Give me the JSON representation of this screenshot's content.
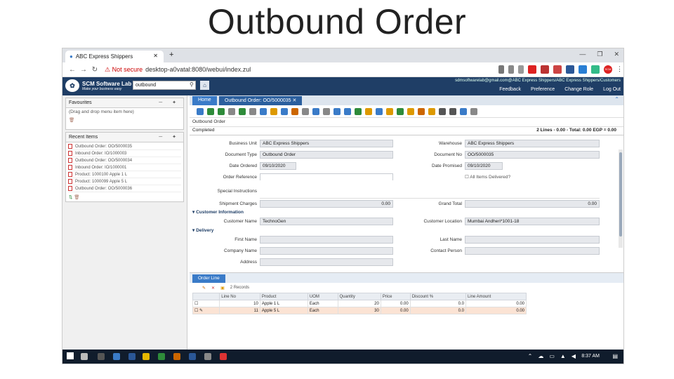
{
  "slide": {
    "title": "Outbound Order"
  },
  "browser": {
    "tab_title": "ABC Express Shippers",
    "security": "Not secure",
    "url": "desktop-a0vatal:8080/webui/index.zul",
    "profile_badge": "SCM"
  },
  "app": {
    "logo_title": "SCM Software Lab",
    "logo_subtitle": "Make your business easy",
    "search_value": "outbound",
    "user_line": "sdmsoftwarelab@gmail.com@ABC Express Shippers/ABC Express Shippers/Customers",
    "menu": [
      "Feedback",
      "Preference",
      "Change Role",
      "Log Out"
    ]
  },
  "left": {
    "favourites": {
      "title": "Favourites",
      "hint": "(Drag and drop menu item here)"
    },
    "recent": {
      "title": "Recent Items",
      "items": [
        "Outbound Order: OO/5000035",
        "Inbound Order: IO/1000003",
        "Outbound Order: OO/5000034",
        "Inbound Order: IO/1000001",
        "Product: 1000100 Apple 1 L",
        "Product: 1000099 Apple 5 L",
        "Outbound Order: OO/5000036"
      ]
    }
  },
  "main": {
    "tabs": [
      "Home",
      "Outbound Order: OO/5000035"
    ],
    "section_title": "Outbound Order",
    "status": "Completed",
    "summary": "2 Lines - 0.00 - Total: 0.00 EGP = 0.00",
    "fields": {
      "business_unit_label": "Business Unit",
      "business_unit": "ABC Express Shippers",
      "warehouse_label": "Warehouse",
      "warehouse": "ABC Express Shippers",
      "document_type_label": "Document Type",
      "document_type": "Outbound Order",
      "document_no_label": "Document No",
      "document_no": "OO/5000035",
      "date_ordered_label": "Date Ordered",
      "date_ordered": "09/10/2020",
      "date_promised_label": "Date Promised",
      "date_promised": "09/10/2020",
      "order_reference_label": "Order Reference",
      "all_items_label": "All Items Delivered?",
      "special_instructions_label": "Special Instructions",
      "shipment_charges_label": "Shipment Charges",
      "shipment_charges": "0.00",
      "grand_total_label": "Grand Total",
      "grand_total": "0.00",
      "customer_info_group": "Customer Information",
      "customer_name_label": "Customer Name",
      "customer_name": "TechnoGen",
      "customer_location_label": "Customer Location",
      "customer_location": "Mumbai Andheri*1001-18",
      "delivery_group": "Delivery",
      "first_name_label": "First Name",
      "last_name_label": "Last Name",
      "company_name_label": "Company Name",
      "contact_person_label": "Contact Person",
      "address_label": "Address"
    },
    "order_line_tab": "Order Line",
    "records": "2 Records",
    "grid": {
      "columns": [
        "",
        "Line No",
        "Product",
        "UOM",
        "Quantity",
        "Price",
        "Discount %",
        "Line Amount"
      ],
      "rows": [
        {
          "line": "10",
          "product": "Apple 1 L",
          "uom": "Each",
          "qty": "20",
          "price": "0.00",
          "disc": "0.0",
          "amount": "0.00"
        },
        {
          "line": "11",
          "product": "Apple 5 L",
          "uom": "Each",
          "qty": "30",
          "price": "0.00",
          "disc": "0.0",
          "amount": "0.00"
        }
      ]
    }
  },
  "taskbar": {
    "clock": "8:37 AM"
  },
  "colors": {
    "header": "#1f3e66",
    "tab_active": "#3a7bc8",
    "selected_row": "#fbe3d4"
  }
}
